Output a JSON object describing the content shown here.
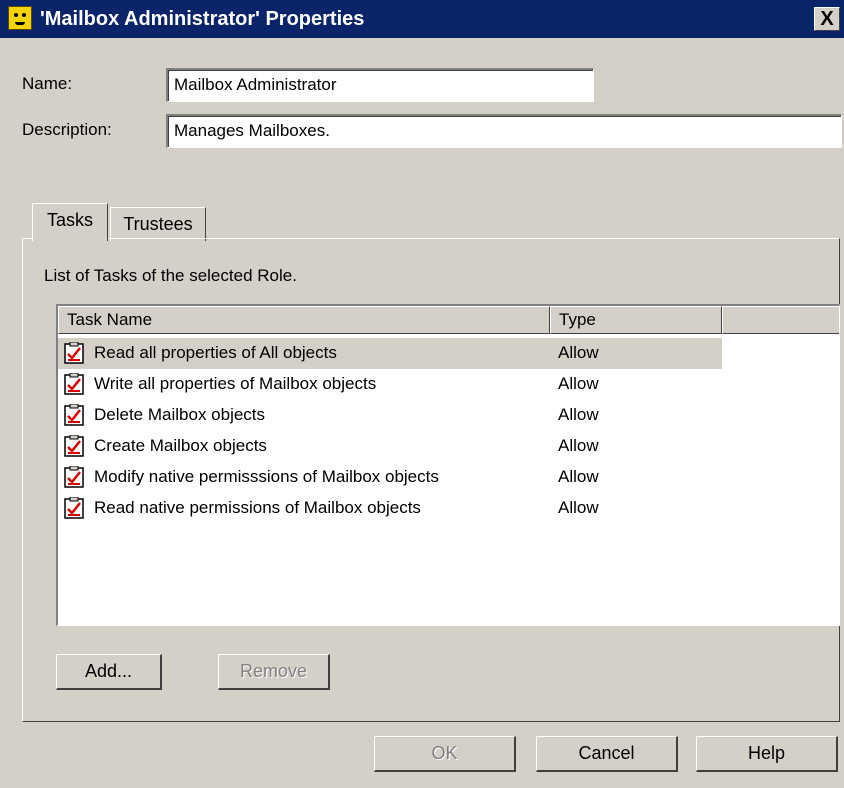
{
  "window": {
    "title": "'Mailbox Administrator' Properties",
    "close_label": "X"
  },
  "form": {
    "name_label": "Name:",
    "name_value": "Mailbox Administrator",
    "description_label": "Description:",
    "description_value": "Manages Mailboxes."
  },
  "tabs": [
    {
      "label": "Tasks",
      "active": true
    },
    {
      "label": "Trustees",
      "active": false
    }
  ],
  "panel": {
    "caption": "List of Tasks of the selected Role.",
    "columns": [
      "Task Name",
      "Type"
    ],
    "rows": [
      {
        "name": "Read all properties of All objects",
        "type": "Allow",
        "selected": true
      },
      {
        "name": "Write all properties of Mailbox objects",
        "type": "Allow"
      },
      {
        "name": "Delete Mailbox objects",
        "type": "Allow"
      },
      {
        "name": "Create Mailbox objects",
        "type": "Allow"
      },
      {
        "name": "Modify native permisssions of Mailbox objects",
        "type": "Allow"
      },
      {
        "name": "Read native permissions of Mailbox objects",
        "type": "Allow"
      }
    ],
    "add_label": "Add...",
    "remove_label": "Remove"
  },
  "buttons": {
    "ok": "OK",
    "cancel": "Cancel",
    "help": "Help"
  }
}
